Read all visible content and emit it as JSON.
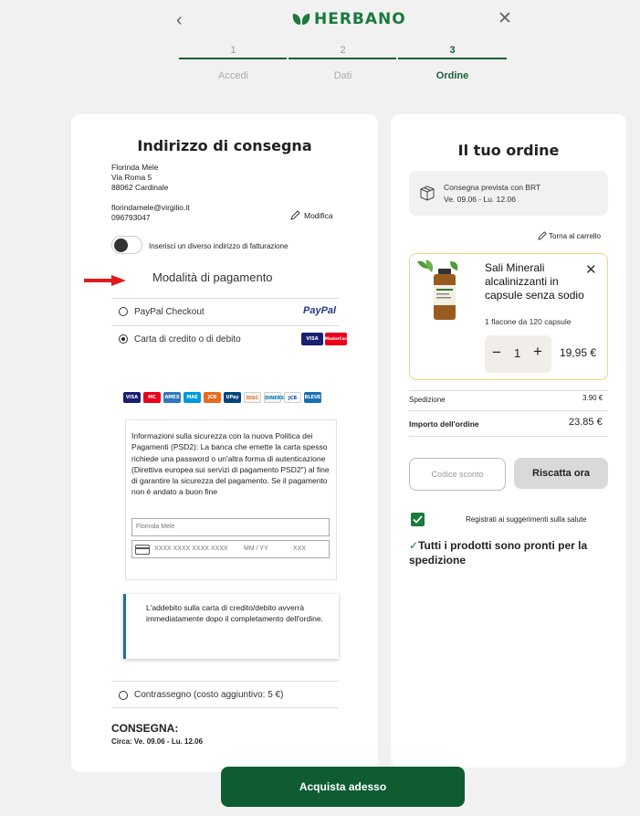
{
  "header": {
    "brand": "HERBANO",
    "steps": [
      {
        "num": "1",
        "label": "Accedi"
      },
      {
        "num": "2",
        "label": "Dati"
      },
      {
        "num": "3",
        "label": "Ordine"
      }
    ]
  },
  "address": {
    "title": "Indirizzo di consegna",
    "name": "Florinda Mele",
    "street": "Via Roma 5",
    "city": "88062 Cardinale",
    "email": "florindamele@virgilio.it",
    "phone": "096793047",
    "edit_label": "Modifica",
    "billing_toggle_label": "Inserisci un diverso indirizzo di fatturazione"
  },
  "payment": {
    "title": "Modalità di pagamento",
    "paypal_label": "PayPal Checkout",
    "paypal_logo": "PayPal",
    "card_label": "Carta di credito o di debito",
    "card_logo_visa": "VISA",
    "card_logo_mc": "MasterCard",
    "card_icons": [
      "VISA",
      "MC",
      "AMEX",
      "MAE",
      "JCB",
      "UPay",
      "DISC",
      "DINERS",
      "JCB",
      "BLEUE"
    ],
    "security_info": "Informazioni sulla sicurezza con la nuova Politica dei Pagamenti (PSD2): La banca che emette la carta spesso richiede una password o un'altra forma di autenticazione (Direttiva europea sui servizi di pagamento PSD2\") al fine di garantire la sicurezza del pagamento. Se il pagamento non è andato a buon fine",
    "cardholder_value": "Florinda Mele",
    "card_number_placeholder": "XXXX XXXX XXXX XXXX",
    "expiry_placeholder": "MM / YY",
    "cvc_placeholder": "XXX",
    "notice": "L'addebito sulla carta di credito/debito avverrà immediatamente dopo il completamento dell'ordine.",
    "cod_label": "Contrassegno (costo aggiuntivo: 5 €)"
  },
  "delivery": {
    "title": "CONSEGNA:",
    "window": "Circa: Ve. 09.06 - Lu. 12.06"
  },
  "buy_button": "Acquista adesso",
  "order": {
    "title": "Il tuo ordine",
    "shipping_info_line1": "Consegna prevista con BRT",
    "shipping_info_line2": "Ve. 09.06 - Lu. 12.06",
    "back_to_cart": "Torna al carrello",
    "product_name": "Sali Minerali alcalinizzanti in capsule senza sodio",
    "product_variant": "1 flacone da 120 capsule",
    "quantity": "1",
    "product_price": "19,95 €",
    "shipping_label": "Spedizione",
    "shipping_value": "3.90 €",
    "total_label": "Importo dell'ordine",
    "total_value": "23.85 €",
    "coupon_placeholder": "Codice sconto",
    "redeem_label": "Riscatta ora",
    "register_label": "Registrati ai suggerimenti sulla salute",
    "ready_text": "Tutti i prodotti sono pronti per la spedizione"
  },
  "colors": {
    "brand_green": "#1b7a3c",
    "dark_green": "#0f5c33",
    "product_border": "#f0d77c",
    "notice_accent": "#1d6bb3"
  }
}
